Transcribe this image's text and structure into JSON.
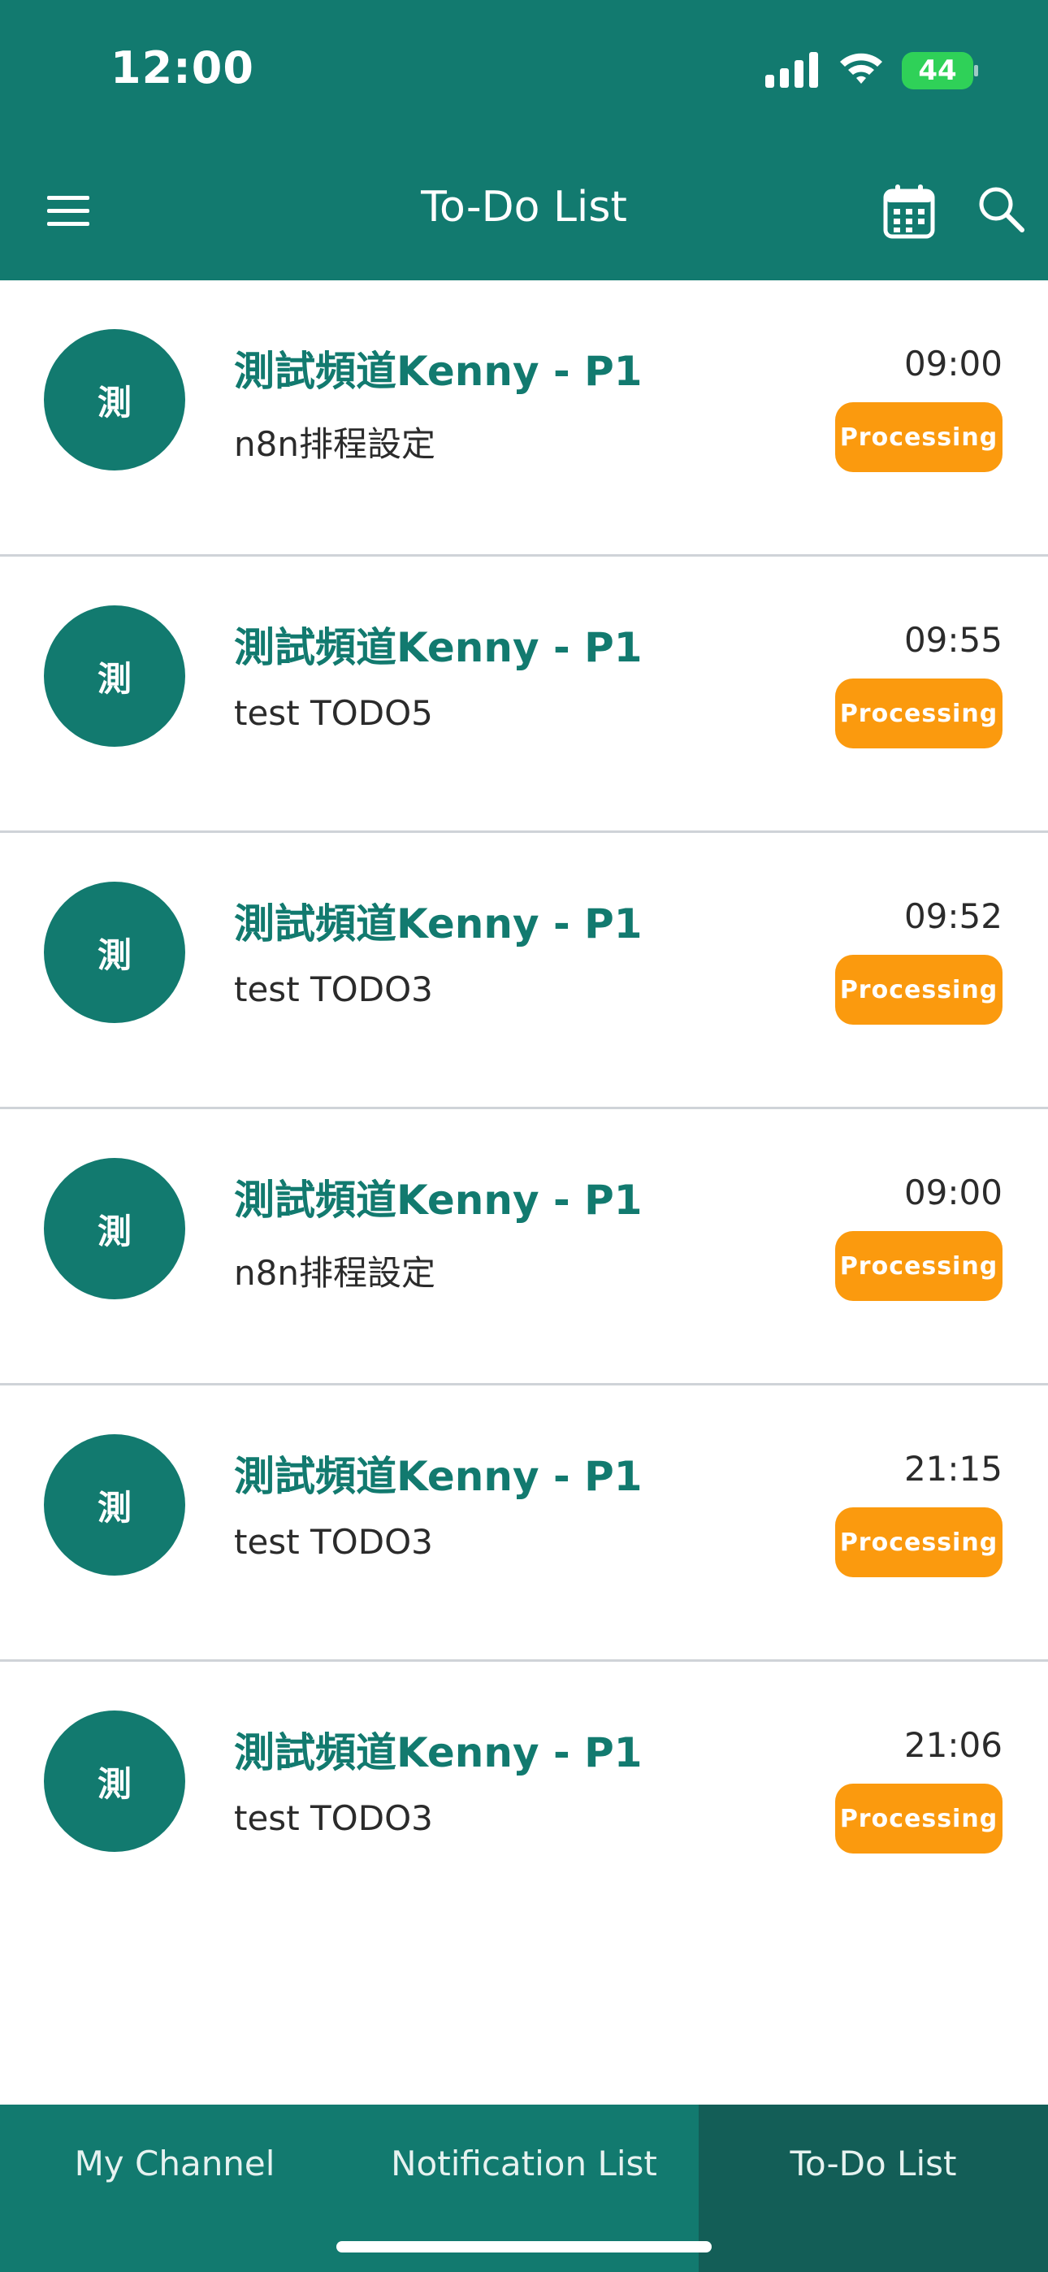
{
  "status_bar": {
    "time": "12:00",
    "battery": "44"
  },
  "app_bar": {
    "title": "To-Do List",
    "icons": {
      "menu": "hamburger-menu-icon",
      "calendar": "calendar-icon",
      "search": "search-icon"
    }
  },
  "items": [
    {
      "avatar": "測",
      "title": "測試頻道Kenny - P1",
      "subtitle": "n8n排程設定",
      "time": "09:00",
      "status": "Processing"
    },
    {
      "avatar": "測",
      "title": "測試頻道Kenny - P1",
      "subtitle": "test TODO5",
      "time": "09:55",
      "status": "Processing"
    },
    {
      "avatar": "測",
      "title": "測試頻道Kenny - P1",
      "subtitle": "test TODO3",
      "time": "09:52",
      "status": "Processing"
    },
    {
      "avatar": "測",
      "title": "測試頻道Kenny - P1",
      "subtitle": "n8n排程設定",
      "time": "09:00",
      "status": "Processing"
    },
    {
      "avatar": "測",
      "title": "測試頻道Kenny - P1",
      "subtitle": "test TODO3",
      "time": "21:15",
      "status": "Processing"
    },
    {
      "avatar": "測",
      "title": "測試頻道Kenny - P1",
      "subtitle": "test TODO3",
      "time": "21:06",
      "status": "Processing"
    }
  ],
  "tabs": [
    {
      "label": "My Channel",
      "active": false
    },
    {
      "label": "Notification List",
      "active": false
    },
    {
      "label": "To-Do List",
      "active": true
    }
  ],
  "colors": {
    "primary": "#127a6f",
    "active_tab": "#135e57",
    "badge": "#fb9a0e",
    "divider": "#cfd3d8",
    "battery": "#2fd158"
  }
}
